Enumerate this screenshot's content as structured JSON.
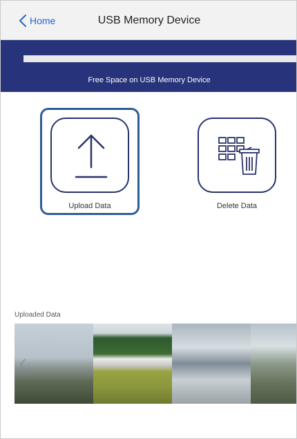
{
  "nav": {
    "back_label": "Home",
    "title": "USB Memory Device",
    "back_icon": "chevron-left-icon"
  },
  "free_space": {
    "label": "Free Space on USB Memory Device",
    "used_fraction": 0
  },
  "actions": {
    "upload": {
      "label": "Upload Data",
      "icon": "upload-arrow-icon"
    },
    "delete": {
      "label": "Delete Data",
      "icon": "grid-trash-icon"
    }
  },
  "uploaded": {
    "label": "Uploaded Data",
    "thumbnails": [
      {
        "name": "thumbnail-1"
      },
      {
        "name": "thumbnail-2"
      },
      {
        "name": "thumbnail-3"
      },
      {
        "name": "thumbnail-4"
      }
    ],
    "prev_icon": "chevron-left-icon"
  },
  "colors": {
    "accent": "#2a63c6",
    "band": "#27337a",
    "selection": "#2c5d95",
    "icon_stroke": "#27336a"
  }
}
